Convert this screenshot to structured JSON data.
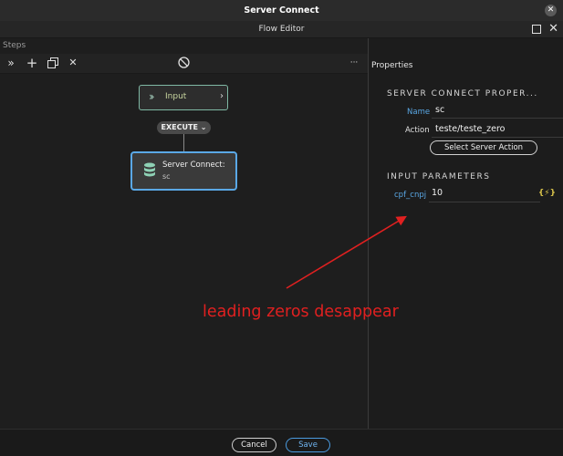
{
  "window": {
    "title": "Server Connect"
  },
  "dialog": {
    "title": "Flow Editor"
  },
  "steps": {
    "label": "Steps",
    "toolbar": {
      "expand": "»",
      "add": "+",
      "delete": "✕",
      "more": "···"
    },
    "nodes": {
      "input": {
        "label": "Input"
      },
      "execute": {
        "label": "EXECUTE"
      },
      "server_connect": {
        "title": "Server Connect:",
        "subtitle": "sc"
      }
    }
  },
  "properties": {
    "title": "Properties",
    "server_connect_section": "SERVER CONNECT PROPER...",
    "name_label": "Name",
    "name_value": "sc",
    "action_label": "Action",
    "action_value": "teste/teste_zero",
    "select_action_button": "Select Server Action",
    "input_params_section": "INPUT PARAMETERS",
    "param_label": "cpf_cnpj",
    "param_value": "10",
    "data_binding_icon": "{⚡}"
  },
  "footer": {
    "cancel": "Cancel",
    "save": "Save"
  },
  "annotation": {
    "text": "leading zeros desappear",
    "color": "#e02020"
  },
  "colors": {
    "accent": "#5aa8e6",
    "input_border": "#7fb8a4",
    "label_blue": "#5aa8e6"
  }
}
